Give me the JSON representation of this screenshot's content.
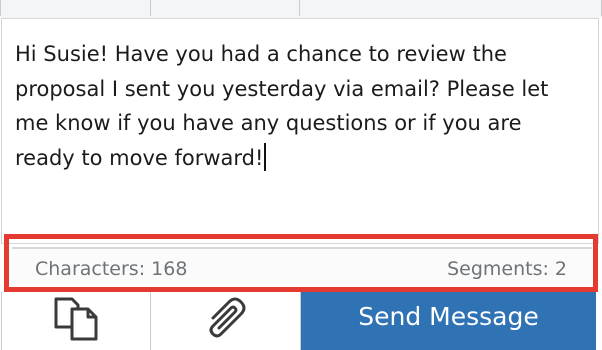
{
  "composer": {
    "message": "Hi Susie! Have you had a chance to review the\nproposal I sent you yesterday via email? Please let\nme know if you have any questions or if you are\nready to move forward!"
  },
  "counter": {
    "characters_label": "Characters: 168",
    "segments_label": "Segments: 2"
  },
  "toolbar": {
    "templates_icon": "copy-icon",
    "attach_icon": "paperclip-icon",
    "send_label": "Send Message"
  },
  "colors": {
    "send_button": "#2f73b5",
    "highlight": "#e53a2f"
  }
}
